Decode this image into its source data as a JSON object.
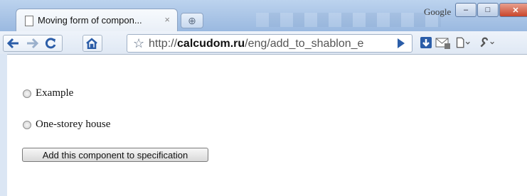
{
  "browser": {
    "google_label": "Google",
    "window_buttons": {
      "minimize": "–",
      "maximize": "□",
      "close": "✕"
    },
    "tab": {
      "title": "Moving form of compon...",
      "close_glyph": "×"
    },
    "new_tab_glyph": "⊕",
    "url": {
      "scheme": "http://",
      "host": "calcudom.ru",
      "path": "/eng/add_to_shablon_e"
    },
    "icons": {
      "back": "back-arrow-icon",
      "forward": "forward-arrow-icon",
      "reload": "reload-icon",
      "home": "home-icon",
      "star": "star-icon",
      "go": "go-arrow-icon",
      "download": "download-icon",
      "mail": "mail-icon",
      "page_menu": "page-menu-icon",
      "wrench": "wrench-icon"
    }
  },
  "form": {
    "options": [
      {
        "label": "Example",
        "selected": false
      },
      {
        "label": "One-storey house",
        "selected": false
      }
    ],
    "submit_label": "Add this component to specification"
  },
  "colors": {
    "accent": "#2b5da8",
    "titlebar": "#a9c4e6",
    "close": "#c9462b"
  }
}
